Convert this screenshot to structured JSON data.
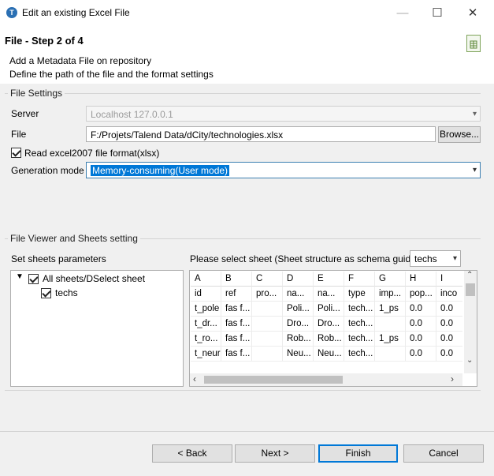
{
  "window": {
    "title": "Edit an existing Excel File",
    "minimize": "—",
    "maximize": "☐",
    "close": "✕"
  },
  "wizard": {
    "step_title": "File - Step 2 of 4",
    "desc_line1": "Add a Metadata File on repository",
    "desc_line2": "Define the path of the file and the format settings"
  },
  "file_settings": {
    "group_label": "File Settings",
    "server_label": "Server",
    "server_value": "Localhost 127.0.0.1",
    "file_label": "File",
    "file_value": "F:/Projets/Talend Data/dCity/technologies.xlsx",
    "browse_label": "Browse...",
    "read_excel_label": "Read excel2007 file format(xlsx)",
    "read_excel_checked": true,
    "generation_label": "Generation mode",
    "generation_value": "Memory-consuming(User mode)"
  },
  "viewer": {
    "group_label": "File Viewer and Sheets setting",
    "sheets_params_label": "Set sheets parameters",
    "select_sheet_label": "Please select sheet (Sheet structure as schema guide)",
    "sheet_value": "techs",
    "tree": [
      {
        "label": "All sheets/DSelect sheet",
        "checked": true,
        "expanded": true
      },
      {
        "label": "techs",
        "checked": true
      }
    ],
    "columns": [
      "A",
      "B",
      "C",
      "D",
      "E",
      "F",
      "G",
      "H",
      "I"
    ],
    "rows": [
      [
        "id",
        "ref",
        "pro...",
        "na...",
        "na...",
        "type",
        "imp...",
        "pop...",
        "inco"
      ],
      [
        "t_pole",
        "fas f...",
        "",
        "Poli...",
        "Poli...",
        "tech...",
        "1_ps",
        "0.0",
        "0.0"
      ],
      [
        "t_dr...",
        "fas f...",
        "",
        "Dro...",
        "Dro...",
        "tech...",
        "",
        "0.0",
        "0.0"
      ],
      [
        "t_ro...",
        "fas f...",
        "",
        "Rob...",
        "Rob...",
        "tech...",
        "1_ps",
        "0.0",
        "0.0"
      ],
      [
        "t_neur",
        "fas f...",
        "",
        "Neu...",
        "Neu...",
        "tech...",
        "",
        "0.0",
        "0.0"
      ]
    ]
  },
  "buttons": {
    "back": "< Back",
    "next": "Next >",
    "finish": "Finish",
    "cancel": "Cancel"
  }
}
